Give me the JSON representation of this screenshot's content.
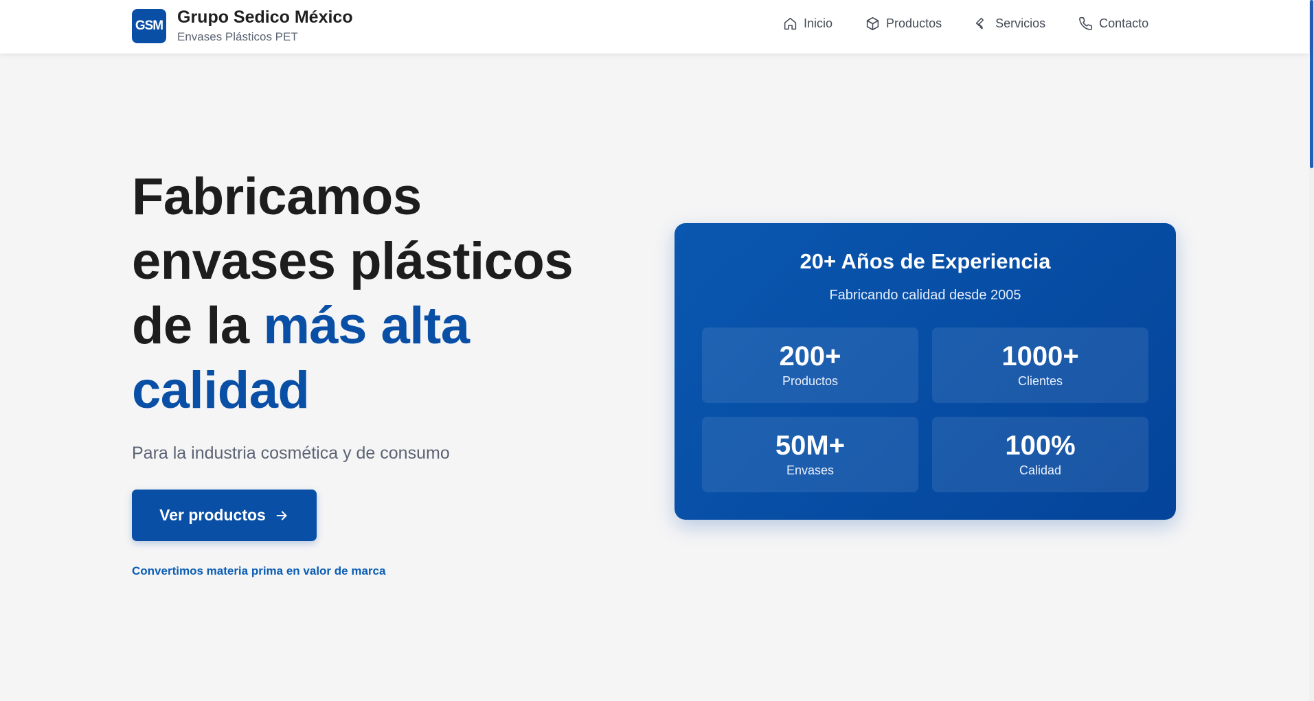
{
  "header": {
    "logo_text": "GSM",
    "brand_name": "Grupo Sedico México",
    "brand_tagline": "Envases Plásticos PET",
    "nav": [
      {
        "label": "Inicio",
        "icon": "home-icon"
      },
      {
        "label": "Productos",
        "icon": "box-icon"
      },
      {
        "label": "Servicios",
        "icon": "wrench-icon"
      },
      {
        "label": "Contacto",
        "icon": "phone-icon"
      }
    ]
  },
  "hero": {
    "title_line1": "Fabricamos",
    "title_line2": "envases plásticos",
    "title_line3_plain": "de la ",
    "title_line3_accent": "más alta",
    "title_line4_accent": "calidad",
    "subtitle": "Para la industria cosmética y de consumo",
    "cta_label": "Ver productos",
    "tagline": "Convertimos materia prima en valor de marca"
  },
  "experience_card": {
    "title": "20+ Años de Experiencia",
    "subtitle": "Fabricando calidad desde 2005",
    "stats": [
      {
        "value": "200+",
        "label": "Productos"
      },
      {
        "value": "1000+",
        "label": "Clientes"
      },
      {
        "value": "50M+",
        "label": "Envases"
      },
      {
        "value": "100%",
        "label": "Calidad"
      }
    ]
  },
  "colors": {
    "primary": "#0a4fa6",
    "text_dark": "#1d1d1d",
    "text_muted": "#5b6473",
    "background": "#f5f5f6"
  }
}
